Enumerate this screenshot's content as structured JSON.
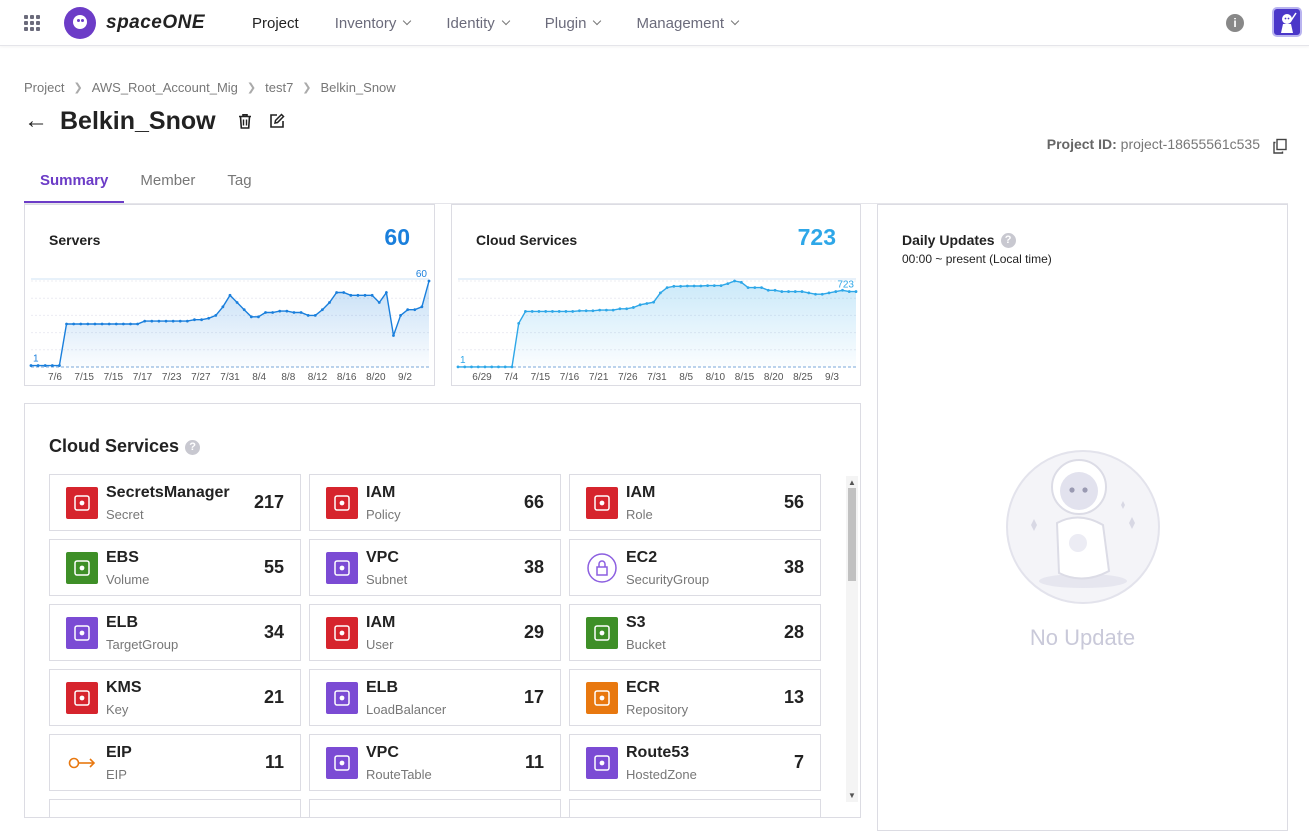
{
  "nav": {
    "brand": "spaceONE",
    "items": [
      {
        "label": "Project",
        "active": true,
        "dropdown": false
      },
      {
        "label": "Inventory",
        "active": false,
        "dropdown": true
      },
      {
        "label": "Identity",
        "active": false,
        "dropdown": true
      },
      {
        "label": "Plugin",
        "active": false,
        "dropdown": true
      },
      {
        "label": "Management",
        "active": false,
        "dropdown": true
      }
    ],
    "info_icon": "info-icon",
    "avatar_icon": "astronaut-avatar-icon"
  },
  "breadcrumb": [
    "Project",
    "AWS_Root_Account_Mig",
    "test7",
    "Belkin_Snow"
  ],
  "page": {
    "title": "Belkin_Snow",
    "project_id_label": "Project ID:",
    "project_id_value": "project-18655561c535"
  },
  "tabs": [
    "Summary",
    "Member",
    "Tag"
  ],
  "servers_card": {
    "title": "Servers",
    "total": "60",
    "color": "#1a7fdc",
    "chart_data": {
      "type": "area",
      "x_ticks": [
        "7/6",
        "7/15",
        "7/15",
        "7/17",
        "7/23",
        "7/27",
        "7/31",
        "8/4",
        "8/8",
        "8/12",
        "8/16",
        "8/20",
        "9/2"
      ],
      "start_label": "1",
      "end_label": "60",
      "values": [
        1,
        1,
        1,
        1,
        1,
        30,
        30,
        30,
        30,
        30,
        30,
        30,
        30,
        30,
        30,
        30,
        32,
        32,
        32,
        32,
        32,
        32,
        32,
        33,
        33,
        34,
        36,
        42,
        50,
        45,
        40,
        35,
        35,
        38,
        38,
        39,
        39,
        38,
        38,
        36,
        36,
        40,
        45,
        52,
        52,
        50,
        50,
        50,
        50,
        45,
        52,
        22,
        36,
        40,
        40,
        42,
        60
      ]
    }
  },
  "cloud_services_card": {
    "title": "Cloud Services",
    "total": "723",
    "color": "#2ea7e8",
    "chart_data": {
      "type": "area",
      "x_ticks": [
        "6/29",
        "7/4",
        "7/15",
        "7/16",
        "7/21",
        "7/26",
        "7/31",
        "8/5",
        "8/10",
        "8/15",
        "8/20",
        "8/25",
        "9/3"
      ],
      "start_label": "1",
      "end_label": "723",
      "values": [
        1,
        1,
        1,
        1,
        1,
        1,
        1,
        1,
        1,
        330,
        420,
        420,
        420,
        420,
        420,
        420,
        420,
        420,
        425,
        425,
        425,
        430,
        430,
        430,
        440,
        440,
        450,
        470,
        480,
        490,
        560,
        600,
        610,
        610,
        612,
        612,
        612,
        615,
        615,
        615,
        630,
        650,
        640,
        600,
        600,
        600,
        580,
        580,
        570,
        570,
        570,
        570,
        560,
        550,
        550,
        560,
        570,
        580,
        570,
        570
      ]
    }
  },
  "cloud_services_list": {
    "title": "Cloud Services",
    "items": [
      {
        "name": "SecretsManager",
        "type": "Secret",
        "count": "217",
        "color": "#d6242d",
        "icon": "secrets-manager-icon"
      },
      {
        "name": "IAM",
        "type": "Policy",
        "count": "66",
        "color": "#d6242d",
        "icon": "iam-icon"
      },
      {
        "name": "IAM",
        "type": "Role",
        "count": "56",
        "color": "#d6242d",
        "icon": "iam-icon"
      },
      {
        "name": "EBS",
        "type": "Volume",
        "count": "55",
        "color": "#3e8f27",
        "icon": "ebs-icon"
      },
      {
        "name": "VPC",
        "type": "Subnet",
        "count": "38",
        "color": "#7b4bd4",
        "icon": "vpc-icon"
      },
      {
        "name": "EC2",
        "type": "SecurityGroup",
        "count": "38",
        "color": "#8c5fe0",
        "icon": "security-group-icon"
      },
      {
        "name": "ELB",
        "type": "TargetGroup",
        "count": "34",
        "color": "#7b4bd4",
        "icon": "elb-icon"
      },
      {
        "name": "IAM",
        "type": "User",
        "count": "29",
        "color": "#d6242d",
        "icon": "iam-icon"
      },
      {
        "name": "S3",
        "type": "Bucket",
        "count": "28",
        "color": "#3e8f27",
        "icon": "s3-icon"
      },
      {
        "name": "KMS",
        "type": "Key",
        "count": "21",
        "color": "#d6242d",
        "icon": "kms-icon"
      },
      {
        "name": "ELB",
        "type": "LoadBalancer",
        "count": "17",
        "color": "#7b4bd4",
        "icon": "elb-icon"
      },
      {
        "name": "ECR",
        "type": "Repository",
        "count": "13",
        "color": "#e8780f",
        "icon": "ecr-icon"
      },
      {
        "name": "EIP",
        "type": "EIP",
        "count": "11",
        "color": "#e8780f",
        "icon": "eip-icon"
      },
      {
        "name": "VPC",
        "type": "RouteTable",
        "count": "11",
        "color": "#7b4bd4",
        "icon": "vpc-icon"
      },
      {
        "name": "Route53",
        "type": "HostedZone",
        "count": "7",
        "color": "#7b4bd4",
        "icon": "route53-icon"
      }
    ]
  },
  "daily_updates": {
    "title": "Daily Updates",
    "subtitle": "00:00 ~ present (Local time)",
    "empty_text": "No Update"
  }
}
